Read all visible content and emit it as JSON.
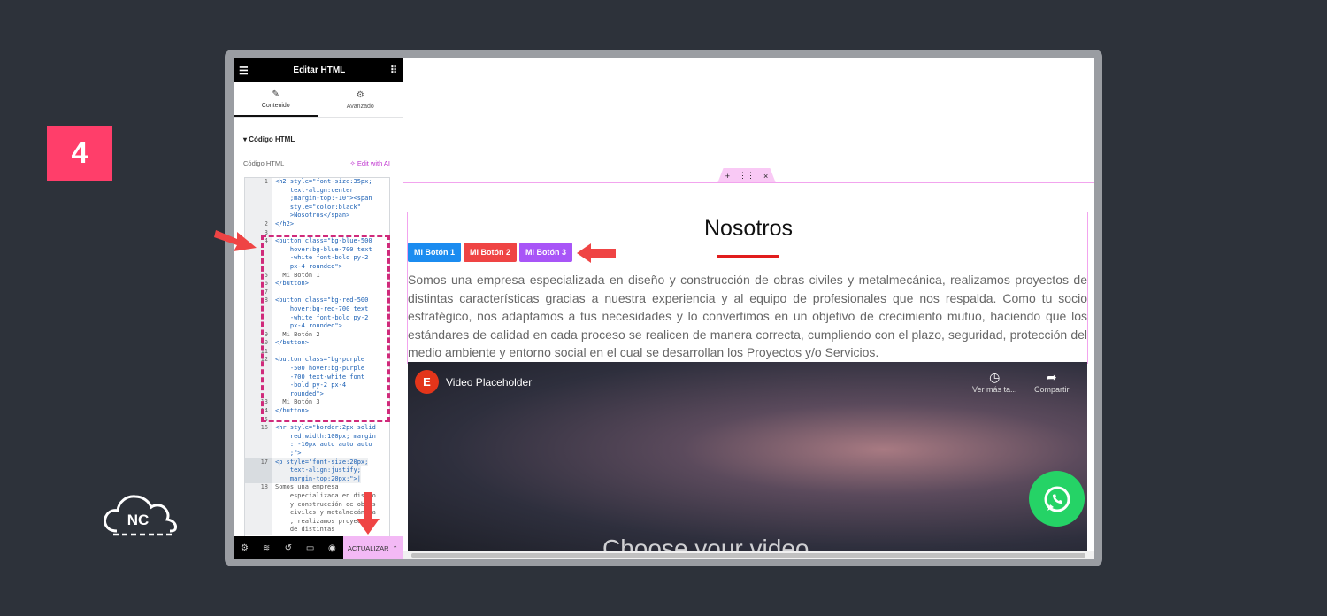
{
  "step": "4",
  "logo": {
    "text": "NC"
  },
  "editor": {
    "title": "Editar HTML",
    "tabs": [
      {
        "label": "Contenido",
        "active": true
      },
      {
        "label": "Avanzado",
        "active": false
      }
    ],
    "section_title": "Código HTML",
    "field_label": "Código HTML",
    "edit_ai": "Edit with AI",
    "code_lines": [
      {
        "n": "1",
        "t": "<h2 style=\"font-size:35px;"
      },
      {
        "n": "",
        "t": "    text-align:center"
      },
      {
        "n": "",
        "t": "    ;margin-top:-10\"><span"
      },
      {
        "n": "",
        "t": "    style=\"color:black\""
      },
      {
        "n": "",
        "t": "    >Nosotros</span>"
      },
      {
        "n": "2",
        "t": "</h2>"
      },
      {
        "n": "3",
        "t": ""
      },
      {
        "n": "4",
        "t": "<button class=\"bg-blue-500"
      },
      {
        "n": "",
        "t": "    hover:bg-blue-700 text"
      },
      {
        "n": "",
        "t": "    -white font-bold py-2"
      },
      {
        "n": "",
        "t": "    px-4 rounded\">"
      },
      {
        "n": "5",
        "t": "  Mi Botón 1"
      },
      {
        "n": "6",
        "t": "</button>"
      },
      {
        "n": "7",
        "t": ""
      },
      {
        "n": "8",
        "t": "<button class=\"bg-red-500"
      },
      {
        "n": "",
        "t": "    hover:bg-red-700 text"
      },
      {
        "n": "",
        "t": "    -white font-bold py-2"
      },
      {
        "n": "",
        "t": "    px-4 rounded\">"
      },
      {
        "n": "9",
        "t": "  Mi Botón 2"
      },
      {
        "n": "10",
        "t": "</button>"
      },
      {
        "n": "11",
        "t": ""
      },
      {
        "n": "12",
        "t": "<button class=\"bg-purple"
      },
      {
        "n": "",
        "t": "    -500 hover:bg-purple"
      },
      {
        "n": "",
        "t": "    -700 text-white font"
      },
      {
        "n": "",
        "t": "    -bold py-2 px-4"
      },
      {
        "n": "",
        "t": "    rounded\">"
      },
      {
        "n": "13",
        "t": "  Mi Botón 3"
      },
      {
        "n": "14",
        "t": "</button>"
      },
      {
        "n": "15",
        "t": ""
      },
      {
        "n": "16",
        "t": "<hr style=\"border:2px solid"
      },
      {
        "n": "",
        "t": "    red;width:100px; margin"
      },
      {
        "n": "",
        "t": "    : -10px auto auto auto"
      },
      {
        "n": "",
        "t": "    ;\">"
      },
      {
        "n": "17",
        "t": "<p style=\"font-size:20px;"
      },
      {
        "n": "",
        "t": "    text-align:justify;"
      },
      {
        "n": "",
        "t": "    margin-top:20px;\">|"
      },
      {
        "n": "18",
        "t": "Somos una empresa"
      },
      {
        "n": "",
        "t": "    especializada en diseño"
      },
      {
        "n": "",
        "t": "    y construcción de obras"
      },
      {
        "n": "",
        "t": "    civiles y metalmecánica"
      },
      {
        "n": "",
        "t": "    , realizamos proyectos"
      },
      {
        "n": "",
        "t": "    de distintas"
      }
    ],
    "update_label": "ACTUALIZAR"
  },
  "page": {
    "heading": "Nosotros",
    "buttons": [
      "Mi Botón 1",
      "Mi Botón 2",
      "Mi Botón 3"
    ],
    "paragraph": "Somos una empresa especializada en diseño y construcción de obras civiles y metalmecánica, realizamos proyectos de distintas características gracias a nuestra experiencia y al equipo de profesionales que nos respalda. Como tu socio estratégico, nos adaptamos a tus necesidades y lo convertimos en un objetivo de crecimiento mutuo, haciendo que los estándares de calidad en cada proceso se realicen de manera correcta, cumpliendo con el plazo, seguridad, protección del medio ambiente y entorno social en el cual se desarrollan los Proyectos y/o Servicios.",
    "video": {
      "title": "Video Placeholder",
      "watch_later": "Ver más ta...",
      "share": "Compartir",
      "overlay_text": "Choose your video"
    }
  },
  "colors": {
    "badge": "#ff3e6a",
    "button_blue": "#1b8cf0",
    "button_red": "#ef4444",
    "button_purple": "#a855f7",
    "arrow": "#ef4444",
    "whatsapp": "#25d366"
  }
}
